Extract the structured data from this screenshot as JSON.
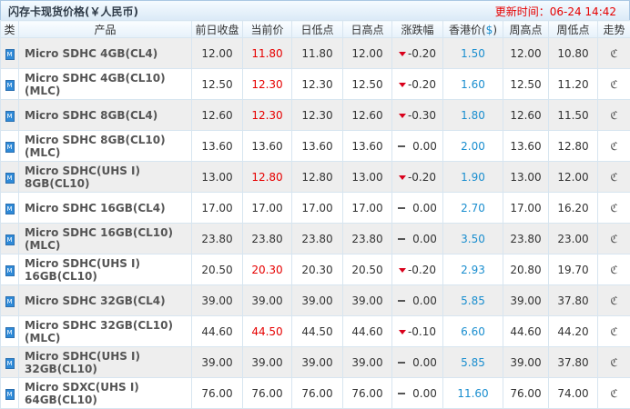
{
  "header": {
    "title": "闪存卡现货价格(￥人民币)",
    "update_label": "更新时间：",
    "update_time": "06-24 14:42"
  },
  "columns": [
    "类",
    "产品",
    "前日收盘",
    "当前价",
    "日低点",
    "日高点",
    "涨跌幅",
    "香港价($)",
    "周高点",
    "周低点",
    "走势"
  ],
  "rows": [
    {
      "product": "Micro SDHC 4GB(CL4)",
      "prev": "12.00",
      "cur": "11.80",
      "cur_color": "red",
      "low": "11.80",
      "high": "12.00",
      "dir": "down",
      "chg": "-0.20",
      "hk": "1.50",
      "whigh": "12.00",
      "wlow": "10.80"
    },
    {
      "product": "Micro SDHC 4GB(CL10)(MLC)",
      "prev": "12.50",
      "cur": "12.30",
      "cur_color": "red",
      "low": "12.30",
      "high": "12.50",
      "dir": "down",
      "chg": "-0.20",
      "hk": "1.60",
      "whigh": "12.50",
      "wlow": "11.20"
    },
    {
      "product": "Micro SDHC 8GB(CL4)",
      "prev": "12.60",
      "cur": "12.30",
      "cur_color": "red",
      "low": "12.30",
      "high": "12.60",
      "dir": "down",
      "chg": "-0.30",
      "hk": "1.80",
      "whigh": "12.60",
      "wlow": "11.50"
    },
    {
      "product": "Micro SDHC 8GB(CL10)(MLC)",
      "prev": "13.60",
      "cur": "13.60",
      "cur_color": "",
      "low": "13.60",
      "high": "13.60",
      "dir": "flat",
      "chg": "0.00",
      "hk": "2.00",
      "whigh": "13.60",
      "wlow": "12.80"
    },
    {
      "product": "Micro SDHC(UHS I) 8GB(CL10)",
      "prev": "13.00",
      "cur": "12.80",
      "cur_color": "red",
      "low": "12.80",
      "high": "13.00",
      "dir": "down",
      "chg": "-0.20",
      "hk": "1.90",
      "whigh": "13.00",
      "wlow": "12.00"
    },
    {
      "product": "Micro SDHC 16GB(CL4)",
      "prev": "17.00",
      "cur": "17.00",
      "cur_color": "",
      "low": "17.00",
      "high": "17.00",
      "dir": "flat",
      "chg": "0.00",
      "hk": "2.70",
      "whigh": "17.00",
      "wlow": "16.20"
    },
    {
      "product": "Micro SDHC 16GB(CL10)(MLC)",
      "prev": "23.80",
      "cur": "23.80",
      "cur_color": "",
      "low": "23.80",
      "high": "23.80",
      "dir": "flat",
      "chg": "0.00",
      "hk": "3.50",
      "whigh": "23.80",
      "wlow": "23.00"
    },
    {
      "product": "Micro SDHC(UHS I) 16GB(CL10)",
      "prev": "20.50",
      "cur": "20.30",
      "cur_color": "red",
      "low": "20.30",
      "high": "20.50",
      "dir": "down",
      "chg": "-0.20",
      "hk": "2.93",
      "whigh": "20.80",
      "wlow": "19.70"
    },
    {
      "product": "Micro SDHC 32GB(CL4)",
      "prev": "39.00",
      "cur": "39.00",
      "cur_color": "",
      "low": "39.00",
      "high": "39.00",
      "dir": "flat",
      "chg": "0.00",
      "hk": "5.85",
      "whigh": "39.00",
      "wlow": "37.80"
    },
    {
      "product": "Micro SDHC 32GB(CL10)(MLC)",
      "prev": "44.60",
      "cur": "44.50",
      "cur_color": "red",
      "low": "44.50",
      "high": "44.60",
      "dir": "down",
      "chg": "-0.10",
      "hk": "6.60",
      "whigh": "44.60",
      "wlow": "44.20"
    },
    {
      "product": "Micro SDHC(UHS I) 32GB(CL10)",
      "prev": "39.00",
      "cur": "39.00",
      "cur_color": "",
      "low": "39.00",
      "high": "39.00",
      "dir": "flat",
      "chg": "0.00",
      "hk": "5.85",
      "whigh": "39.00",
      "wlow": "37.80"
    },
    {
      "product": "Micro SDXC(UHS I) 64GB(CL10)",
      "prev": "76.00",
      "cur": "76.00",
      "cur_color": "",
      "low": "76.00",
      "high": "76.00",
      "dir": "flat",
      "chg": "0.00",
      "hk": "11.60",
      "whigh": "76.00",
      "wlow": "74.00"
    }
  ],
  "icons": {
    "category": "M",
    "trend": "ℭ"
  },
  "colors": {
    "down": "#e60000",
    "hk": "#1a8ecf",
    "header_border": "#a9c7e3",
    "alt_row": "#eeeeee"
  }
}
